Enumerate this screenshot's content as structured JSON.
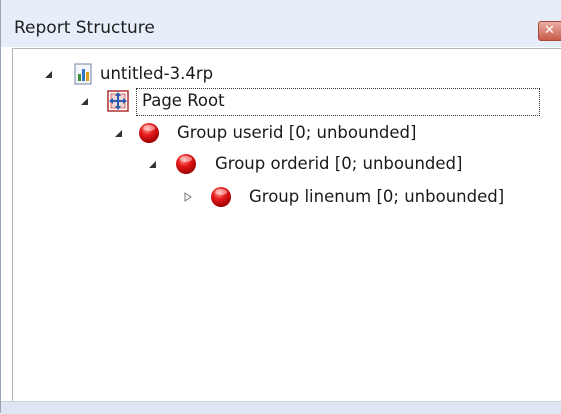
{
  "panel": {
    "title": "Report Structure",
    "close_icon": "close-icon",
    "accent_color": "#e6eef9"
  },
  "tree": {
    "items": [
      {
        "label": "untitled-3.4rp",
        "icon": "report-file-icon",
        "expander": "expanded",
        "selected": false
      },
      {
        "label": "Page Root",
        "icon": "page-root-icon",
        "expander": "expanded",
        "selected": true
      },
      {
        "label": "Group userid [0; unbounded]",
        "icon": "group-red-ball-icon",
        "expander": "expanded",
        "selected": false
      },
      {
        "label": "Group orderid [0; unbounded]",
        "icon": "group-red-ball-icon",
        "expander": "expanded",
        "selected": false
      },
      {
        "label": "Group linenum [0; unbounded]",
        "icon": "group-red-ball-icon",
        "expander": "collapsed",
        "selected": false
      }
    ]
  }
}
